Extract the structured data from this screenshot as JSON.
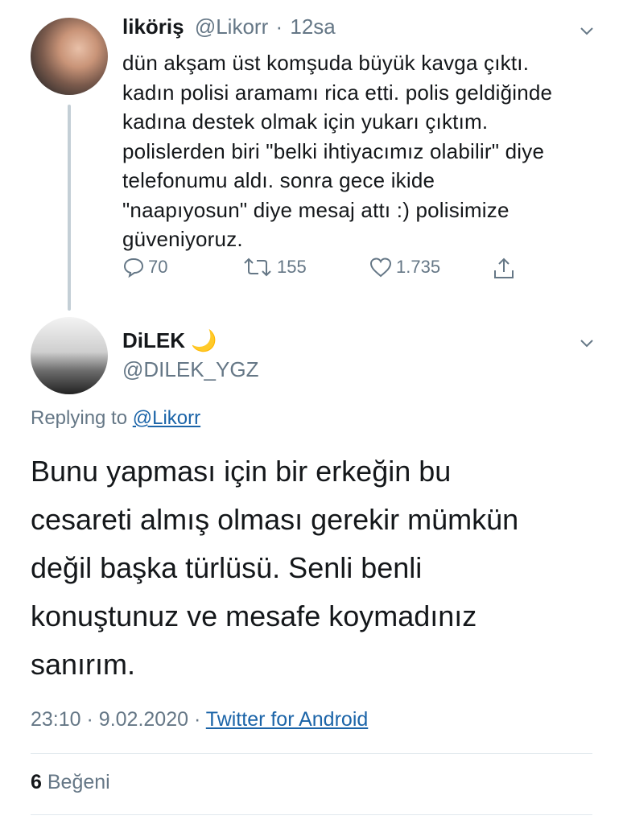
{
  "parent_tweet": {
    "display_name": "liköriş",
    "handle": "@Likorr",
    "time": "12sa",
    "text_lines": [
      "dün akşam üst komşuda büyük kavga çıktı.",
      "kadın polisi aramamı rica etti. polis geldiğinde",
      "kadına destek olmak için yukarı çıktım.",
      "polislerden biri \"belki ihtiyacımız olabilir\" diye",
      "telefonumu aldı. sonra gece ikide",
      "\"naapıyosun\" diye mesaj attı :) polisimize",
      "güveniyoruz."
    ],
    "replies": "70",
    "retweets": "155",
    "likes": "1.735"
  },
  "reply_tweet": {
    "display_name": "DiLEK",
    "name_emoji": "🌙",
    "handle": "@DILEK_YGZ",
    "replying_label": "Replying to",
    "replying_to": "@Likorr",
    "text_lines": [
      "Bunu yapması için bir erkeğin bu",
      "cesareti almış olması gerekir mümkün",
      "değil başka türlüsü. Senli benli",
      "konuştunuz ve mesafe koymadınız",
      "sanırım."
    ],
    "time": "23:10",
    "date": "9.02.2020",
    "source": "Twitter for Android",
    "like_count": "6",
    "like_label": "Beğeni"
  },
  "colors": {
    "text": "#14171a",
    "muted": "#657786",
    "link": "#1b64a8",
    "thread_line": "#c4cfd6"
  },
  "icons": [
    "reply-icon",
    "retweet-icon",
    "like-icon",
    "share-icon",
    "chevron-down-icon",
    "moon-emoji"
  ]
}
